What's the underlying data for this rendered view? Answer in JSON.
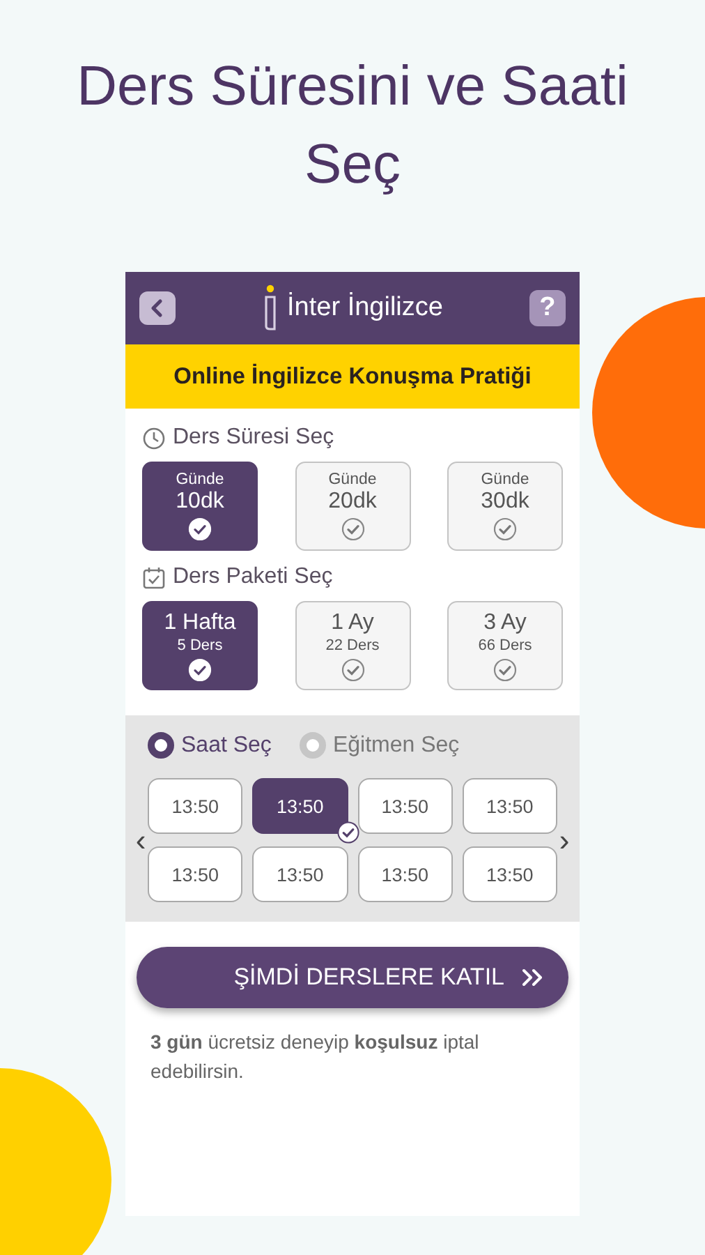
{
  "headline": "Ders Süresini ve Saati Seç",
  "app_bar": {
    "title": "İnter İngilizce",
    "help": "?"
  },
  "banner": "Online İngilizce Konuşma Pratiği",
  "sections": [
    {
      "title": "Ders Süresi Seç",
      "options": [
        {
          "top": "Günde",
          "main": "10dk",
          "selected": true
        },
        {
          "top": "Günde",
          "main": "20dk",
          "selected": false
        },
        {
          "top": "Günde",
          "main": "30dk",
          "selected": false
        }
      ]
    },
    {
      "title": "Ders Paketi Seç",
      "options": [
        {
          "main": "1 Hafta",
          "sub": "5 Ders",
          "selected": true
        },
        {
          "main": "1 Ay",
          "sub": "22 Ders",
          "selected": false
        },
        {
          "main": "3 Ay",
          "sub": "66 Ders",
          "selected": false
        }
      ]
    }
  ],
  "modes": [
    {
      "label": "Saat Seç",
      "selected": true
    },
    {
      "label": "Eğitmen Seç",
      "selected": false
    }
  ],
  "nav": {
    "prev": "‹",
    "next": "›"
  },
  "time_slots": [
    {
      "label": "13:50",
      "selected": false
    },
    {
      "label": "13:50",
      "selected": true
    },
    {
      "label": "13:50",
      "selected": false
    },
    {
      "label": "13:50",
      "selected": false
    },
    {
      "label": "13:50",
      "selected": false
    },
    {
      "label": "13:50",
      "selected": false
    },
    {
      "label": "13:50",
      "selected": false
    },
    {
      "label": "13:50",
      "selected": false
    }
  ],
  "cta": "ŞİMDİ DERSLERE KATIL",
  "note": "**3 gün** ücretsiz deneyip **koşulsuz** iptal edebilirsin."
}
